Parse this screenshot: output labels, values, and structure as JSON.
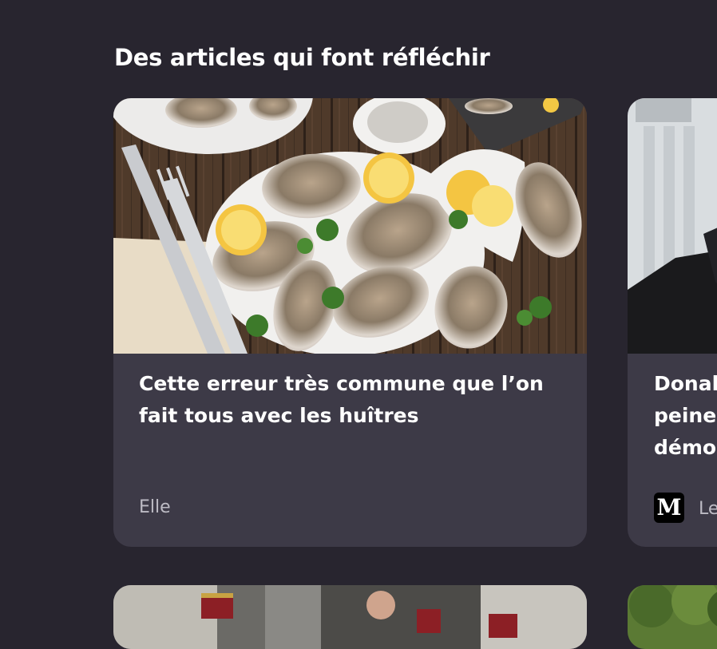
{
  "section": {
    "title": "Des articles qui font réfléchir"
  },
  "cards": [
    {
      "title": "Cette erreur très commune que l’on fait tous avec les huîtres",
      "source": "Elle",
      "image": "oysters-on-plate-photo"
    },
    {
      "title": "Donal\npeine\ndémo",
      "source": "Le",
      "logo_text": "M",
      "image": "man-in-suit-photo"
    }
  ],
  "bottom_cards": [
    {
      "image": "ceremony-guards-photo"
    },
    {
      "image": "trees-photo"
    }
  ]
}
